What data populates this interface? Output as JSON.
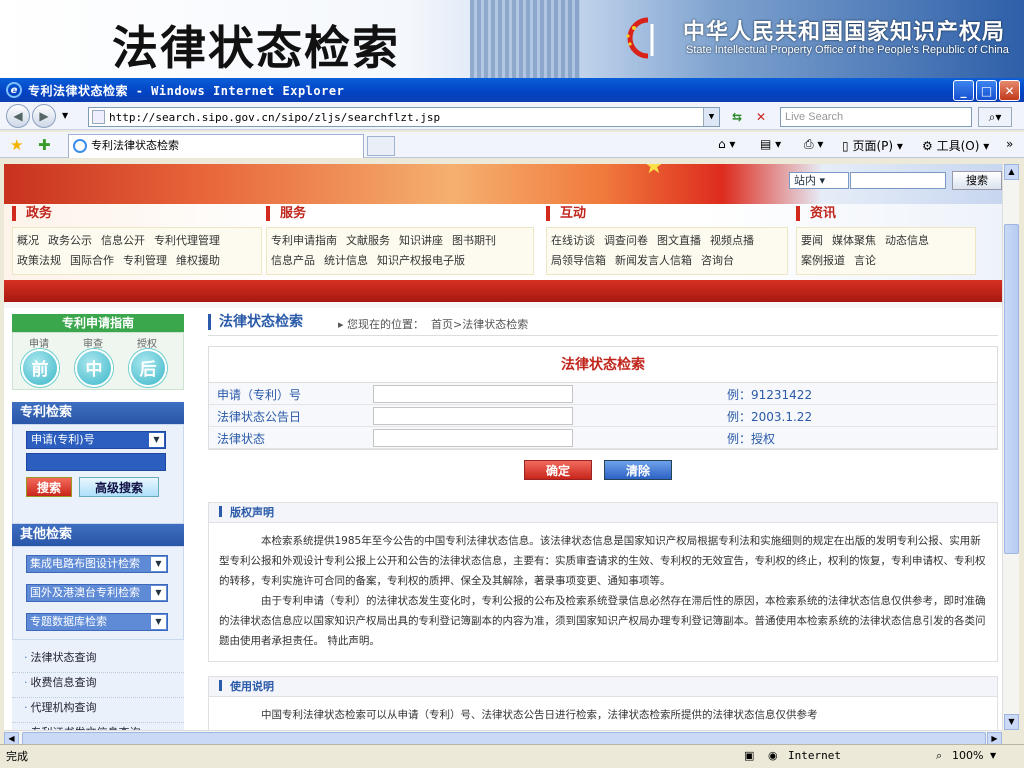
{
  "banner": {
    "title": "法律状态检索",
    "org_cn": "中华人民共和国国家知识产权局",
    "org_en": "State Intellectual Property Office of the People's Republic of China"
  },
  "window": {
    "title": "专利法律状态检索 - Windows Internet Explorer",
    "url": "http://search.sipo.gov.cn/sipo/zljs/searchflzt.jsp",
    "search_placeholder": "Live Search",
    "tab_title": "专利法律状态检索",
    "page_menu": "页面(P)",
    "tools_menu": "工具(O)",
    "status_text": "完成",
    "zone": "Internet",
    "zoom": "100%"
  },
  "site": {
    "search_scope": "站内",
    "search_button": "搜索",
    "menu": [
      {
        "title": "政务",
        "links": [
          "概况",
          "政务公示",
          "信息公开",
          "专利代理管理",
          "政策法规",
          "国际合作",
          "专利管理",
          "维权援助"
        ]
      },
      {
        "title": "服务",
        "links": [
          "专利申请指南",
          "文献服务",
          "知识讲座",
          "图书期刊",
          "信息产品",
          "统计信息",
          "知识产权报电子版"
        ]
      },
      {
        "title": "互动",
        "links": [
          "在线访谈",
          "调查问卷",
          "图文直播",
          "视频点播",
          "局领导信箱",
          "新闻发言人信箱",
          "咨询台"
        ]
      },
      {
        "title": "资讯",
        "links": [
          "要闻",
          "媒体聚焦",
          "动态信息",
          "案例报道",
          "言论"
        ]
      }
    ]
  },
  "sidebar": {
    "guide_title": "专利申请指南",
    "guide_steps": [
      {
        "caption": "申请",
        "label": "前"
      },
      {
        "caption": "审查",
        "label": "中"
      },
      {
        "caption": "授权",
        "label": "后"
      }
    ],
    "patent_search_title": "专利检索",
    "patent_search_select": "申请(专利)号",
    "search_button": "搜索",
    "advanced_button": "高级搜索",
    "other_search_title": "其他检索",
    "other_selects": [
      "集成电路布图设计检索",
      "国外及港澳台专利检索",
      "专题数据库检索"
    ],
    "quick_links": [
      "法律状态查询",
      "收费信息查询",
      "代理机构查询",
      "专利证书发文信息查询"
    ]
  },
  "main": {
    "section_title": "法律状态检索",
    "breadcrumb_prefix": "您现在的位置：",
    "breadcrumb": "首页>法律状态检索",
    "form_title": "法律状态检索",
    "fields": [
      {
        "label": "申请（专利）号",
        "example": "例：91231422"
      },
      {
        "label": "法律状态公告日",
        "example": "例：2003.1.22"
      },
      {
        "label": "法律状态",
        "example": "例：授权"
      }
    ],
    "ok_button": "确定",
    "clear_button": "清除",
    "copyright_title": "版权声明",
    "copyright_p1": "本检索系统提供1985年至今公告的中国专利法律状态信息。该法律状态信息是国家知识产权局根据专利法和实施细则的规定在出版的发明专利公报、实用新型专利公报和外观设计专利公报上公开和公告的法律状态信息，主要有：实质审查请求的生效、专利权的无效宣告，专利权的终止，权利的恢复，专利申请权、专利权的转移，专利实施许可合同的备案，专利权的质押、保全及其解除，著录事项变更、通知事项等。",
    "copyright_p2": "由于专利申请（专利）的法律状态发生变化时，专利公报的公布及检索系统登录信息必然存在滞后性的原因，本检索系统的法律状态信息仅供参考，即时准确的法律状态信息应以国家知识产权局出具的专利登记簿副本的内容为准，须到国家知识产权局办理专利登记簿副本。普通使用本检索系统的法律状态信息引发的各类问题由使用者承担责任。 特此声明。",
    "usage_title": "使用说明",
    "usage_p1": "中国专利法律状态检索可以从申请（专利）号、法律状态公告日进行检索，法律状态检索所提供的法律状态信息仅供参考"
  }
}
